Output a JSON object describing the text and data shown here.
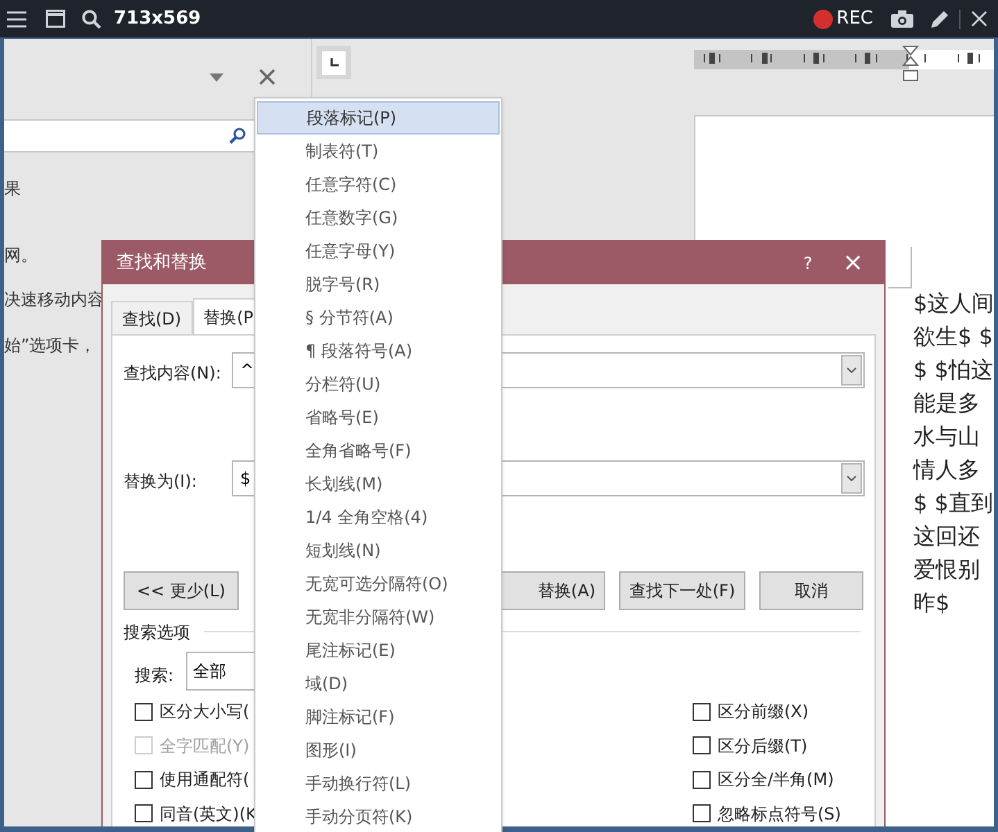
{
  "capture_bar": {
    "size": "713x569",
    "rec": "REC"
  },
  "nav_pane": {
    "lines": [
      "果",
      "网。",
      "决速移动内容",
      "始”选项卡，"
    ]
  },
  "document": {
    "lines": [
      "$这人间",
      "欲生$ $",
      "$ $怕这",
      "能是多",
      "水与山",
      "情人多",
      "$ $直到",
      "这回还",
      "爱恨别",
      "昨$"
    ]
  },
  "dialog": {
    "title": "查找和替换",
    "help": "?",
    "close": "×",
    "tabs": [
      {
        "label": "查找(D)",
        "selected": false
      },
      {
        "label": "替换(P",
        "selected": true
      }
    ],
    "find": {
      "label": "查找内容(N):",
      "value": "^"
    },
    "replace": {
      "label": "替换为(I):",
      "value": "$"
    },
    "buttons": [
      {
        "label": "<< 更少(L)",
        "kind": "less"
      },
      {
        "label": "替换(A)",
        "kind": "partial"
      },
      {
        "label": "查找下一处(F)",
        "kind": "normal"
      },
      {
        "label": "取消",
        "kind": "normal"
      }
    ],
    "options_heading": "搜索选项",
    "search_label": "搜索:",
    "search_value": "全部",
    "left_options": [
      {
        "label": "区分大小写(",
        "checked": false,
        "disabled": false
      },
      {
        "label": "全字匹配(Y)",
        "checked": false,
        "disabled": true
      },
      {
        "label": "使用通配符(",
        "checked": false,
        "disabled": false
      },
      {
        "label": "同音(英文)(K",
        "checked": false,
        "disabled": false
      }
    ],
    "right_options": [
      {
        "label": "区分前缀(X)",
        "checked": false,
        "disabled": false
      },
      {
        "label": "区分后缀(T)",
        "checked": false,
        "disabled": false
      },
      {
        "label": "区分全/半角(M)",
        "checked": false,
        "disabled": false
      },
      {
        "label": "忽略标点符号(S)",
        "checked": false,
        "disabled": false
      }
    ]
  },
  "special_menu": [
    {
      "label": "段落标记(P)",
      "selected": true
    },
    {
      "label": "制表符(T)",
      "selected": false
    },
    {
      "label": "任意字符(C)",
      "selected": false
    },
    {
      "label": "任意数字(G)",
      "selected": false
    },
    {
      "label": "任意字母(Y)",
      "selected": false
    },
    {
      "label": "脱字号(R)",
      "selected": false
    },
    {
      "label": "§ 分节符(A)",
      "selected": false
    },
    {
      "label": "¶ 段落符号(A)",
      "selected": false
    },
    {
      "label": "分栏符(U)",
      "selected": false
    },
    {
      "label": "省略号(E)",
      "selected": false
    },
    {
      "label": "全角省略号(F)",
      "selected": false
    },
    {
      "label": "长划线(M)",
      "selected": false
    },
    {
      "label": "1/4 全角空格(4)",
      "selected": false
    },
    {
      "label": "短划线(N)",
      "selected": false
    },
    {
      "label": "无宽可选分隔符(O)",
      "selected": false
    },
    {
      "label": "无宽非分隔符(W)",
      "selected": false
    },
    {
      "label": "尾注标记(E)",
      "selected": false
    },
    {
      "label": "域(D)",
      "selected": false
    },
    {
      "label": "脚注标记(F)",
      "selected": false
    },
    {
      "label": "图形(I)",
      "selected": false
    },
    {
      "label": "手动换行符(L)",
      "selected": false
    },
    {
      "label": "手动分页符(K)",
      "selected": false
    }
  ]
}
